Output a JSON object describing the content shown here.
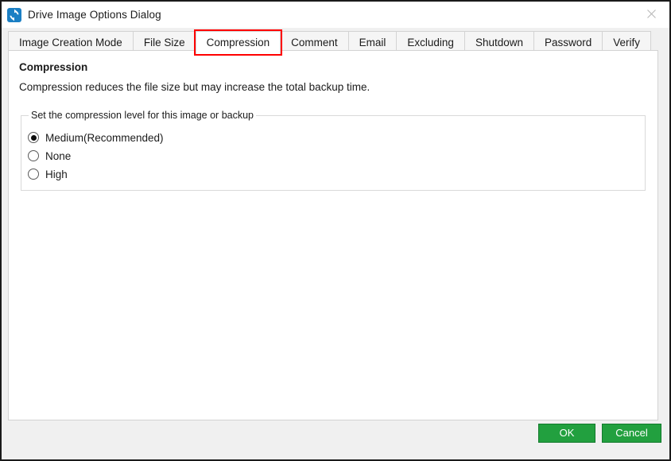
{
  "window": {
    "title": "Drive Image Options Dialog",
    "icon": "refresh-sync-icon",
    "close_label": "✕"
  },
  "tabs": [
    {
      "label": "Image Creation Mode",
      "selected": false,
      "highlighted": false
    },
    {
      "label": "File Size",
      "selected": false,
      "highlighted": false
    },
    {
      "label": "Compression",
      "selected": true,
      "highlighted": true
    },
    {
      "label": "Comment",
      "selected": false,
      "highlighted": false
    },
    {
      "label": "Email",
      "selected": false,
      "highlighted": false
    },
    {
      "label": "Excluding",
      "selected": false,
      "highlighted": false
    },
    {
      "label": "Shutdown",
      "selected": false,
      "highlighted": false
    },
    {
      "label": "Password",
      "selected": false,
      "highlighted": false
    },
    {
      "label": "Verify",
      "selected": false,
      "highlighted": false
    }
  ],
  "panel": {
    "heading": "Compression",
    "description": "Compression reduces the file size but may increase the total backup time.",
    "groupbox": {
      "legend": "Set the compression level for this image or backup",
      "options": [
        {
          "label": "Medium(Recommended)",
          "checked": true
        },
        {
          "label": "None",
          "checked": false
        },
        {
          "label": "High",
          "checked": false
        }
      ]
    }
  },
  "footer": {
    "ok_label": "OK",
    "cancel_label": "Cancel"
  },
  "colors": {
    "highlight": "#ff0000",
    "button_green": "#22a03f",
    "button_green_border": "#127a2c",
    "titlebar_bg": "#ffffff",
    "dialog_bg": "#f0f0f0",
    "panel_bg": "#ffffff"
  }
}
